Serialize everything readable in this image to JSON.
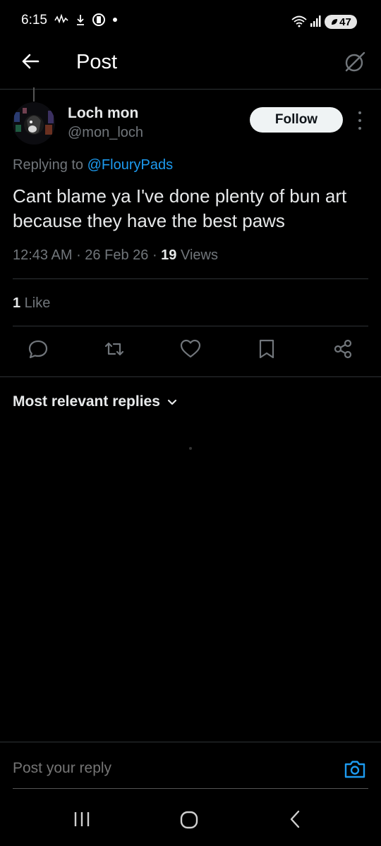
{
  "status_bar": {
    "time": "6:15",
    "battery": "47"
  },
  "header": {
    "title": "Post"
  },
  "tweet": {
    "author_name": "Loch mon",
    "author_handle": "@mon_loch",
    "follow_label": "Follow",
    "replying_prefix": "Replying to ",
    "replying_to": "@FlouryPads",
    "text": "Cant blame ya I've done plenty of bun art because they have the best paws",
    "time": "12:43 AM",
    "date": "26 Feb 26",
    "views_count": "19",
    "views_label": " Views",
    "likes_count": "1",
    "likes_label": " Like"
  },
  "replies": {
    "sort_label": "Most relevant replies"
  },
  "composer": {
    "placeholder": "Post your reply"
  },
  "colors": {
    "background": "#000000",
    "accent": "#1d9bf0",
    "divider": "#2f3336",
    "muted": "#71767b"
  },
  "icons": [
    "back-arrow-icon",
    "grok-icon",
    "more-icon",
    "reply-icon",
    "repost-icon",
    "like-icon",
    "bookmark-icon",
    "share-icon",
    "chevron-down-icon",
    "camera-icon",
    "recents-icon",
    "home-icon",
    "back-icon"
  ]
}
